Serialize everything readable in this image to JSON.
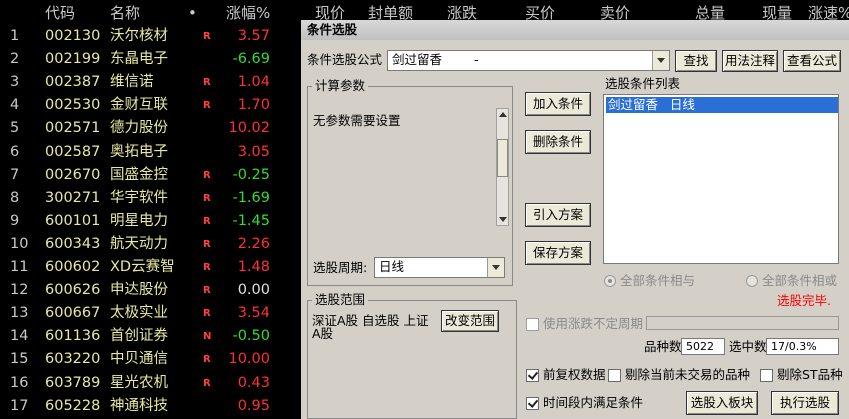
{
  "columns": {
    "code": "代码",
    "name": "名称",
    "dot": "•",
    "pct": "涨幅%",
    "price": "现价",
    "seal": "封单额",
    "change": "涨跌",
    "bid": "买价",
    "ask": "卖价",
    "volume": "总量",
    "current": "现量",
    "speed": "涨速%"
  },
  "stocks": [
    {
      "idx": "1",
      "code": "002130",
      "name": "沃尔核材",
      "flag": "R",
      "pct": "3.57",
      "dir": "up"
    },
    {
      "idx": "2",
      "code": "002199",
      "name": "东晶电子",
      "flag": "",
      "pct": "-6.69",
      "dir": "down"
    },
    {
      "idx": "3",
      "code": "002387",
      "name": "维信诺",
      "flag": "R",
      "pct": "1.04",
      "dir": "up"
    },
    {
      "idx": "4",
      "code": "002530",
      "name": "金财互联",
      "flag": "R",
      "pct": "1.70",
      "dir": "up"
    },
    {
      "idx": "5",
      "code": "002571",
      "name": "德力股份",
      "flag": "",
      "pct": "10.02",
      "dir": "up"
    },
    {
      "idx": "6",
      "code": "002587",
      "name": "奥拓电子",
      "flag": "",
      "pct": "3.05",
      "dir": "up"
    },
    {
      "idx": "7",
      "code": "002670",
      "name": "国盛金控",
      "flag": "R",
      "pct": "-0.25",
      "dir": "down"
    },
    {
      "idx": "8",
      "code": "300271",
      "name": "华宇软件",
      "flag": "R",
      "pct": "-1.69",
      "dir": "down"
    },
    {
      "idx": "9",
      "code": "600101",
      "name": "明星电力",
      "flag": "R",
      "pct": "-1.45",
      "dir": "down"
    },
    {
      "idx": "10",
      "code": "600343",
      "name": "航天动力",
      "flag": "R",
      "pct": "2.26",
      "dir": "up"
    },
    {
      "idx": "11",
      "code": "600602",
      "name": "XD云赛智",
      "flag": "R",
      "pct": "1.48",
      "dir": "up"
    },
    {
      "idx": "12",
      "code": "600626",
      "name": "申达股份",
      "flag": "R",
      "pct": "0.00",
      "dir": "flat"
    },
    {
      "idx": "13",
      "code": "600667",
      "name": "太极实业",
      "flag": "R",
      "pct": "3.54",
      "dir": "up"
    },
    {
      "idx": "14",
      "code": "601136",
      "name": "首创证券",
      "flag": "N",
      "pct": "-0.50",
      "dir": "down"
    },
    {
      "idx": "15",
      "code": "603220",
      "name": "中贝通信",
      "flag": "R",
      "pct": "10.00",
      "dir": "up"
    },
    {
      "idx": "16",
      "code": "603789",
      "name": "星光农机",
      "flag": "R",
      "pct": "0.43",
      "dir": "up"
    },
    {
      "idx": "17",
      "code": "605228",
      "name": "神通科技",
      "flag": "",
      "pct": "0.95",
      "dir": "up"
    }
  ],
  "dialog": {
    "title": "条件选股",
    "formula_label": "条件选股公式",
    "formula_value": "剑过留香",
    "formula_suffix": "-",
    "btn_find": "查找",
    "btn_usage": "用法注释",
    "btn_view": "查看公式",
    "params_title": "计算参数",
    "params_text": "无参数需要设置",
    "period_label": "选股周期:",
    "period_value": "日线",
    "btn_add": "加入条件",
    "btn_delete": "删除条件",
    "btn_import": "引入方案",
    "btn_save": "保存方案",
    "list_title": "选股条件列表",
    "list_items": [
      "剑过留香   日线"
    ],
    "radio_and": "全部条件相与",
    "radio_or": "全部条件相或",
    "status": "选股完毕.",
    "scope_title": "选股范围",
    "scope_text_1": "深证A股 自选股 上证",
    "scope_text_2": "A股",
    "btn_scope": "改变范围",
    "chk_uncertain": "使用涨跌不定周期",
    "count_label": "品种数",
    "count_value": "5022",
    "selected_label": "选中数",
    "selected_value": "17/0.3%",
    "chk_restore": "前复权数据",
    "chk_exclude_untraded": "剔除当前未交易的品种",
    "chk_exclude_st": "剔除ST品种",
    "chk_period": "时间段内满足条件",
    "btn_to_block": "选股入板块",
    "btn_execute": "执行选股"
  },
  "colors": {
    "up": "#ff3030",
    "down": "#33dd33",
    "code": "#e8e8a0",
    "status": "#ff0000",
    "selection": "#2a6fd6"
  }
}
